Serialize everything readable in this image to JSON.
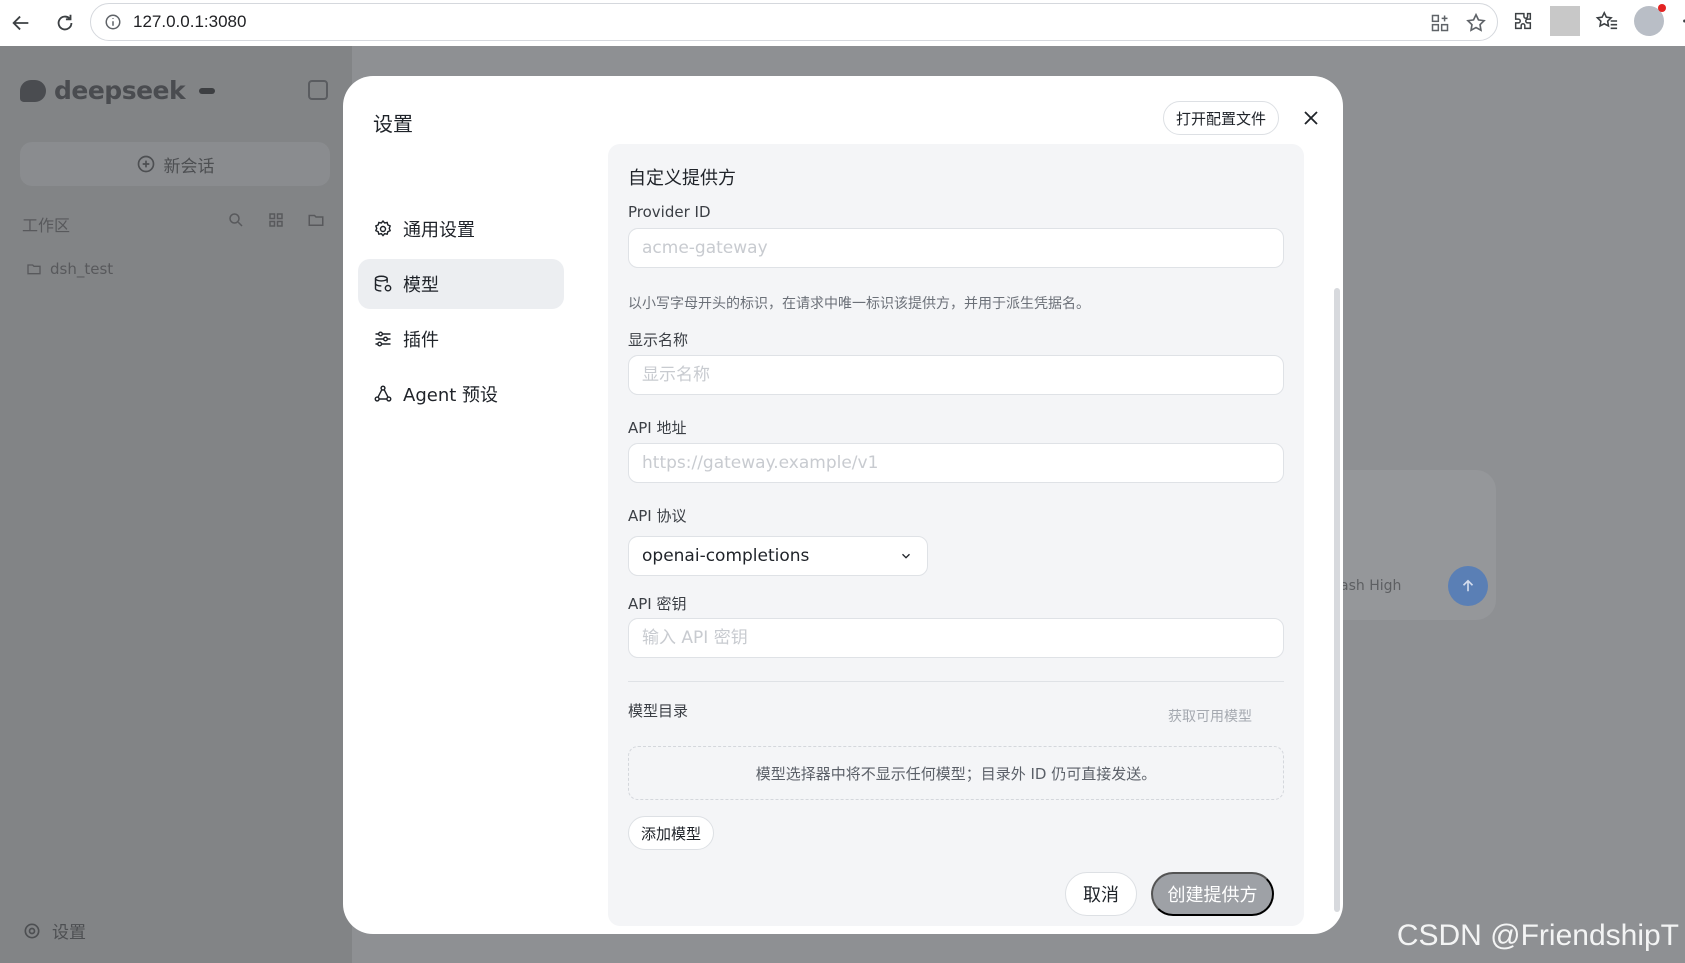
{
  "browser": {
    "url": "127.0.0.1:3080"
  },
  "app": {
    "logo_text": "deepseek",
    "logo_badge": "",
    "new_chat": "新会话",
    "workspace_label": "工作区",
    "folder_name": "dsh_test",
    "settings_label": "设置",
    "model_hint": "ash High"
  },
  "watermark": "CSDN @FriendshipT",
  "modal": {
    "title": "设置",
    "open_config": "打开配置文件",
    "nav": [
      {
        "label": "通用设置",
        "icon": "gear-icon"
      },
      {
        "label": "模型",
        "icon": "database-icon"
      },
      {
        "label": "插件",
        "icon": "sliders-icon"
      },
      {
        "label": "Agent 预设",
        "icon": "agent-icon"
      }
    ],
    "active_nav": "模型",
    "form": {
      "section_title": "自定义提供方",
      "provider_id_label": "Provider ID",
      "provider_id_placeholder": "acme-gateway",
      "provider_id_value": "",
      "provider_id_hint": "以小写字母开头的标识，在请求中唯一标识该提供方，并用于派生凭据名。",
      "display_name_label": "显示名称",
      "display_name_placeholder": "显示名称",
      "display_name_value": "",
      "api_url_label": "API 地址",
      "api_url_placeholder": "https://gateway.example/v1",
      "api_url_value": "",
      "api_protocol_label": "API 协议",
      "api_protocol_value": "openai-completions",
      "api_key_label": "API 密钥",
      "api_key_placeholder": "输入 API 密钥",
      "api_key_value": "",
      "catalog_label": "模型目录",
      "fetch_models": "获取可用模型",
      "empty_catalog": "模型选择器中将不显示任何模型；目录外 ID 仍可直接发送。",
      "add_model": "添加模型",
      "cancel": "取消",
      "create": "创建提供方"
    }
  },
  "colors": {
    "panel_bg": "#f4f5f7",
    "active_nav_bg": "#eceef1",
    "create_btn_disabled": "#9ea1a6",
    "overlay": "#8b8d90"
  }
}
